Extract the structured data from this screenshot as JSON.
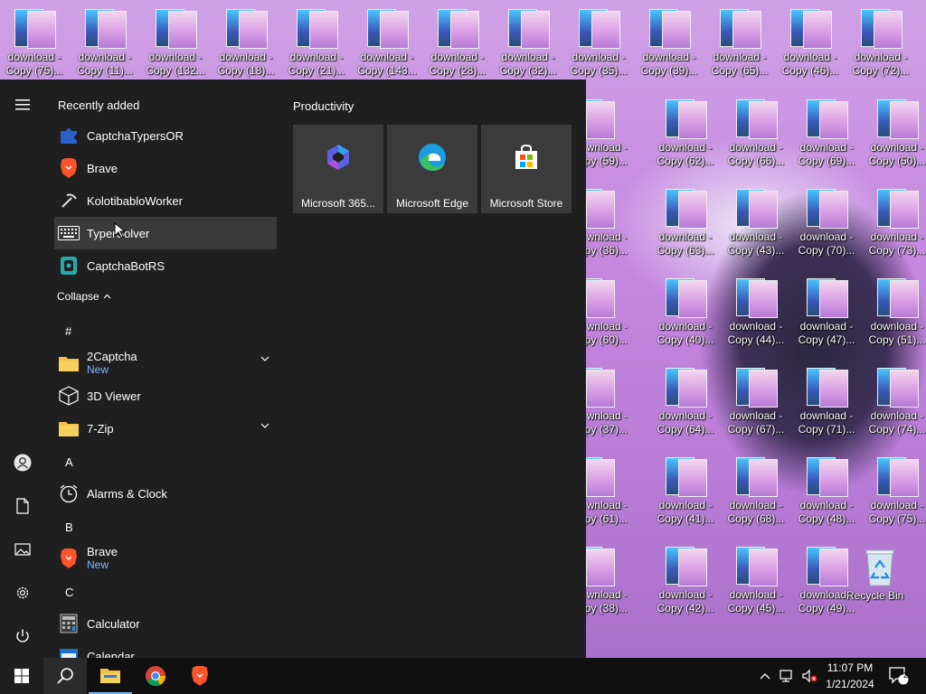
{
  "desktop": {
    "top_icons": [
      {
        "l1": "download -",
        "l2": "Copy (75)..."
      },
      {
        "l1": "download -",
        "l2": "Copy (11)..."
      },
      {
        "l1": "download -",
        "l2": "Copy (132..."
      },
      {
        "l1": "download -",
        "l2": "Copy (18)..."
      },
      {
        "l1": "download -",
        "l2": "Copy (21)..."
      },
      {
        "l1": "download -",
        "l2": "Copy (143..."
      },
      {
        "l1": "download -",
        "l2": "Copy (28)..."
      },
      {
        "l1": "download -",
        "l2": "Copy (32)..."
      },
      {
        "l1": "download -",
        "l2": "Copy (35)..."
      },
      {
        "l1": "download -",
        "l2": "Copy (39)..."
      },
      {
        "l1": "download -",
        "l2": "Copy (65)..."
      },
      {
        "l1": "download -",
        "l2": "Copy (46)..."
      },
      {
        "l1": "download -",
        "l2": "Copy (72)..."
      }
    ],
    "grid_rows": [
      [
        {
          "l1": "wnload -",
          "l2": "py (59)..."
        },
        {
          "l1": "download -",
          "l2": "Copy (62)..."
        },
        {
          "l1": "download -",
          "l2": "Copy (66)..."
        },
        {
          "l1": "download -",
          "l2": "Copy (69)..."
        },
        {
          "l1": "download -",
          "l2": "Copy (50)..."
        }
      ],
      [
        {
          "l1": "wnload -",
          "l2": "py (36)..."
        },
        {
          "l1": "download -",
          "l2": "Copy (63)..."
        },
        {
          "l1": "download -",
          "l2": "Copy (43)..."
        },
        {
          "l1": "download -",
          "l2": "Copy (70)..."
        },
        {
          "l1": "download -",
          "l2": "Copy (73)..."
        }
      ],
      [
        {
          "l1": "wnload -",
          "l2": "py (60)..."
        },
        {
          "l1": "download -",
          "l2": "Copy (40)..."
        },
        {
          "l1": "download -",
          "l2": "Copy (44)..."
        },
        {
          "l1": "download -",
          "l2": "Copy (47)..."
        },
        {
          "l1": "download -",
          "l2": "Copy (51)..."
        }
      ],
      [
        {
          "l1": "wnload -",
          "l2": "py (37)..."
        },
        {
          "l1": "download -",
          "l2": "Copy (64)..."
        },
        {
          "l1": "download -",
          "l2": "Copy (67)..."
        },
        {
          "l1": "download -",
          "l2": "Copy (71)..."
        },
        {
          "l1": "download -",
          "l2": "Copy (74)..."
        }
      ],
      [
        {
          "l1": "wnload -",
          "l2": "py (61)..."
        },
        {
          "l1": "download -",
          "l2": "Copy (41)..."
        },
        {
          "l1": "download -",
          "l2": "Copy (68)..."
        },
        {
          "l1": "download -",
          "l2": "Copy (48)..."
        },
        {
          "l1": "download -",
          "l2": "Copy (75)..."
        }
      ],
      [
        {
          "l1": "wnload -",
          "l2": "py (38)..."
        },
        {
          "l1": "download -",
          "l2": "Copy (42)..."
        },
        {
          "l1": "download -",
          "l2": "Copy (45)..."
        },
        {
          "l1": "download -",
          "l2": "Copy (49)..."
        }
      ]
    ],
    "recycle_bin": "Recycle Bin"
  },
  "start_menu": {
    "recently_added_label": "Recently added",
    "recent": [
      {
        "label": "CaptchaTypersOR",
        "icon": "puzzle-icon"
      },
      {
        "label": "Brave",
        "icon": "brave-lion-icon"
      },
      {
        "label": "KolotibabloWorker",
        "icon": "pickaxe-icon"
      },
      {
        "label": "TyperSolver",
        "icon": "keyboard-icon"
      },
      {
        "label": "CaptchaBotRS",
        "icon": "bot-icon"
      }
    ],
    "collapse_label": "Collapse",
    "hash_letter": "#",
    "apps_hash": [
      {
        "label": "2Captcha",
        "sub": "New",
        "icon": "folder-icon"
      },
      {
        "label": "3D Viewer",
        "icon": "cube-icon"
      },
      {
        "label": "7-Zip",
        "icon": "folder-icon"
      }
    ],
    "letter_a": "A",
    "alarms": "Alarms & Clock",
    "letter_b": "B",
    "brave": {
      "label": "Brave",
      "sub": "New"
    },
    "letter_c": "C",
    "calculator": "Calculator",
    "calendar": "Calendar",
    "group_title": "Productivity",
    "tiles": [
      {
        "label": "Microsoft 365...",
        "icon": "microsoft-365-icon"
      },
      {
        "label": "Microsoft Edge",
        "icon": "edge-icon"
      },
      {
        "label": "Microsoft Store",
        "icon": "store-icon"
      }
    ]
  },
  "taskbar": {
    "time": "11:07 PM",
    "date": "1/21/2024",
    "notifications": "2"
  }
}
